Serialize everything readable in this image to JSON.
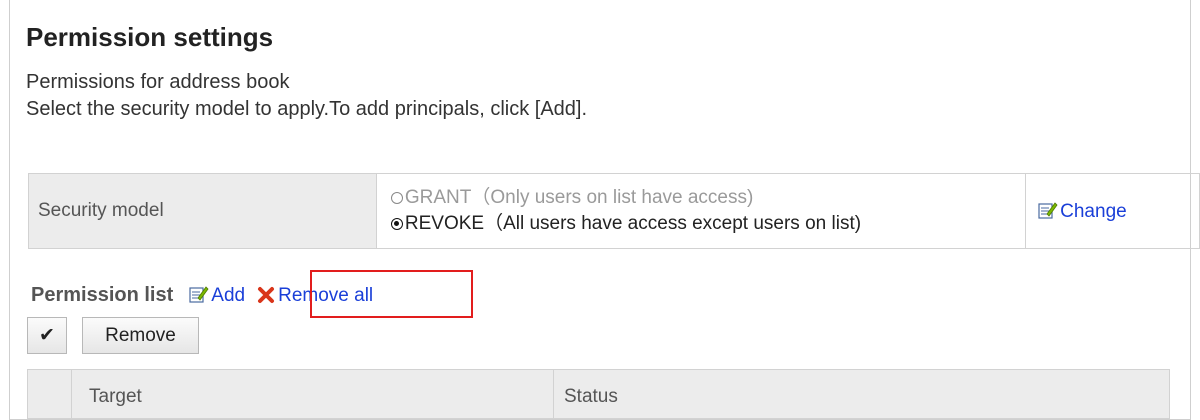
{
  "page": {
    "title": "Permission settings",
    "description_line1": "Permissions for address book",
    "description_line2": "Select the security model to apply.To add principals, click [Add]."
  },
  "security_model": {
    "label": "Security model",
    "options": [
      {
        "text": "GRANT（Only users on list have access)",
        "selected": false
      },
      {
        "text": "REVOKE（All users have access except users on list)",
        "selected": true
      }
    ],
    "change_label": "Change"
  },
  "permission_list": {
    "title": "Permission list",
    "add_label": "Add",
    "remove_all_label": "Remove all",
    "check_button_label": "✔",
    "remove_button_label": "Remove",
    "columns": [
      "Target",
      "Status"
    ]
  },
  "colors": {
    "link": "#1a3fd8",
    "highlight_box": "#e21d1d",
    "header_bg": "#ececec"
  },
  "icons": {
    "change": "edit-icon",
    "add": "edit-icon",
    "remove_all": "x-icon"
  }
}
